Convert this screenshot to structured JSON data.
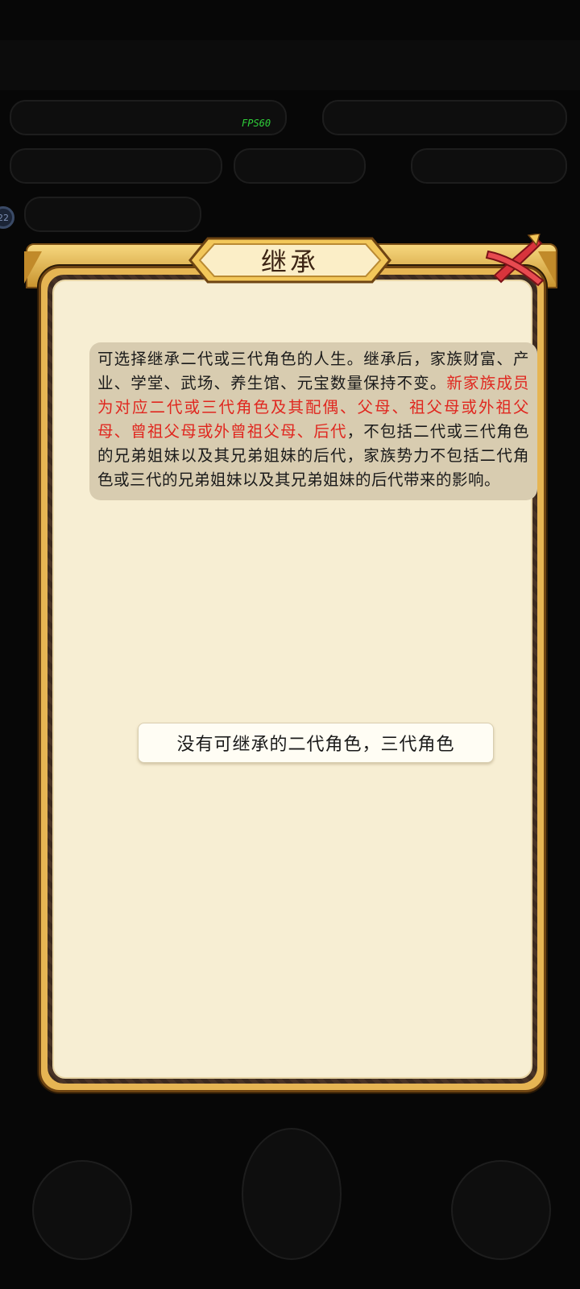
{
  "overlay": {
    "fps_label": "FPS60",
    "badge_value": "22"
  },
  "dialog": {
    "title": "继承",
    "description_parts": [
      "可选择继承二代或三代角色的人生。继承后，家族财富、产业、学堂、武场、养生馆、元宝数量保持不变。",
      "新家族成员为对应二代或三代角色及其配偶、父母、祖父母或外祖父母、曾祖父母或外曾祖父母、后代",
      "，不包括二代或三代角色的兄弟姐妹以及其兄弟姐妹的后代，家族势力不包括二代角色或三代的兄弟姐妹以及其兄弟姐妹的后代带来的影响。"
    ],
    "empty_message": "没有可继承的二代角色，三代角色"
  },
  "colors": {
    "highlight_text": "#e0271f",
    "panel_bg": "#f7eed3",
    "frame_gold": "#e6b553",
    "close_red": "#d8343c"
  },
  "icons": {
    "close": "close-x-icon"
  }
}
